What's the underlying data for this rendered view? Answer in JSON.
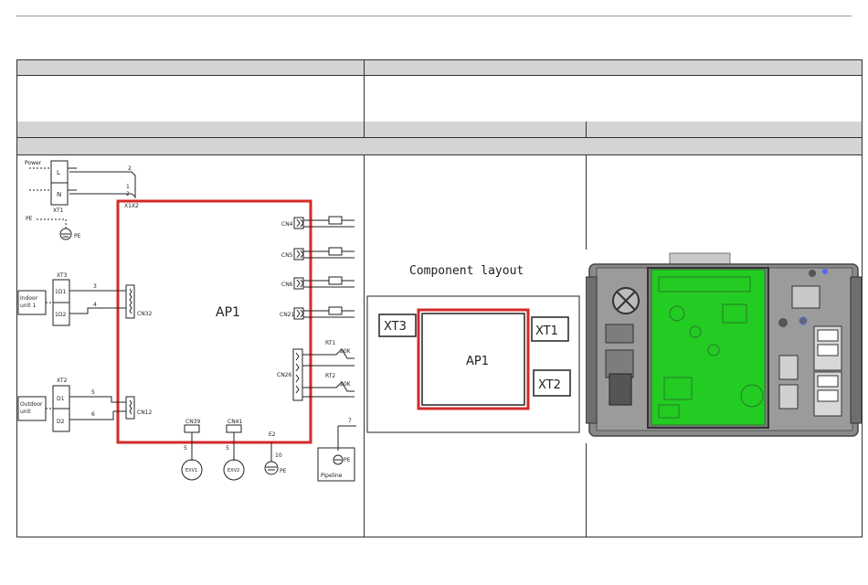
{
  "wiring": {
    "power_label": "Power",
    "l_label": "L",
    "n_label": "N",
    "xt1": "XT1",
    "pe": "PE",
    "x1x2": "X1X2",
    "ap1": "AP1",
    "xt3": "XT3",
    "td1": "1D1",
    "td2": "1D2",
    "indoor": [
      "Indoor",
      "unit 1"
    ],
    "xt2": "XT2",
    "d1": "D1",
    "d2": "D2",
    "outdoor": [
      "Outdoor",
      "unit"
    ],
    "cn32": "CN32",
    "cn12": "CN12",
    "cn4": "CN4",
    "cn5": "CN5",
    "cn6": "CN6",
    "cn21": "CN21",
    "cn26": "CN26",
    "cn39": "CN39",
    "cn41": "CN41",
    "e2": "E2",
    "rt1": "RT1",
    "rt2": "RT2",
    "r20k": "20K",
    "exv1": "EXV1",
    "exv2": "EXV2",
    "pipeline": "Pipeline",
    "wire_nums": [
      "2",
      "1",
      "2",
      "3",
      "4",
      "5",
      "6",
      "5",
      "5",
      "10",
      "7"
    ]
  },
  "layout_panel": {
    "title": "Component layout",
    "ap1": "AP1",
    "xt1": "XT1",
    "xt2": "XT2",
    "xt3": "XT3"
  },
  "colors": {
    "highlight_red": "#d42a2a",
    "pcb_green": "#22cc22",
    "chassis_gray": "#7a7a7a"
  }
}
